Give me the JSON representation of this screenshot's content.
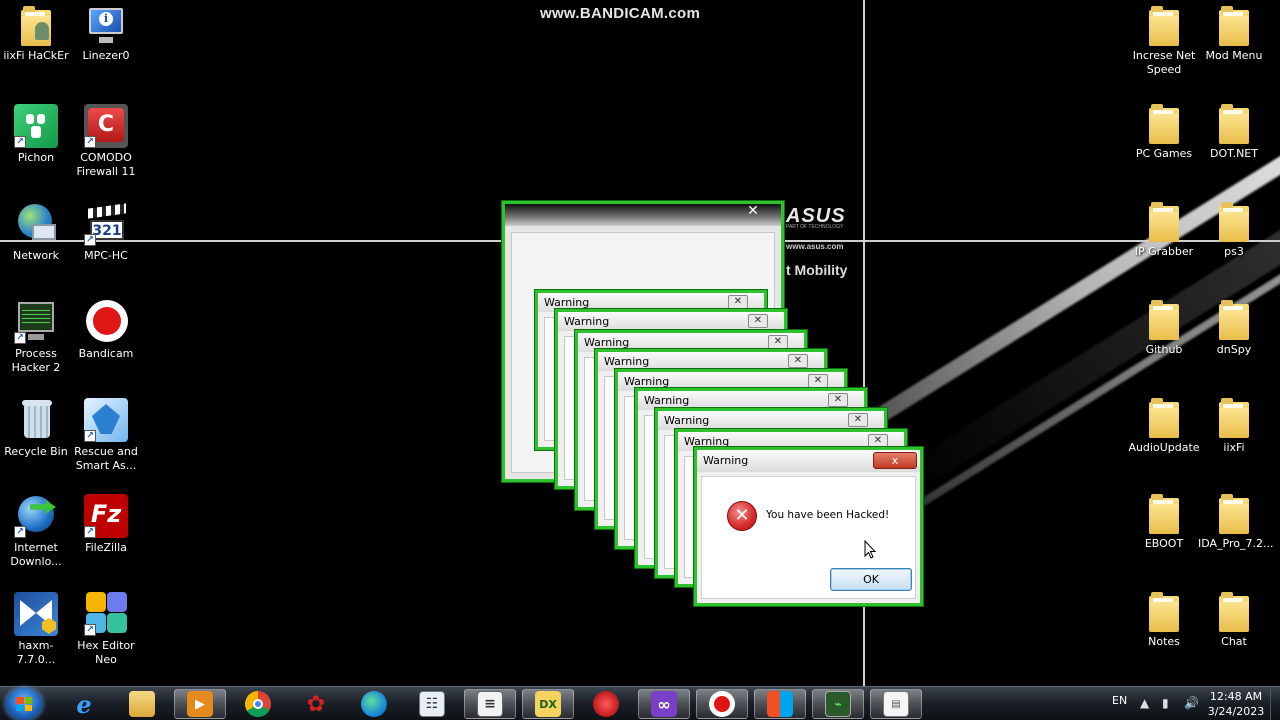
{
  "watermark": "www.BANDICAM.com",
  "wallpaper": {
    "brand": "ASUS",
    "tagline": "PART OF TECHNOLOGY",
    "url": "www.asus.com",
    "slogan": "t Mobility"
  },
  "desktop_left": [
    {
      "label": "iixFi HaCkEr",
      "icon": "folder-user-icon"
    },
    {
      "label": "Linezer0",
      "icon": "monitor-info-icon"
    },
    {
      "label": "Pichon",
      "icon": "pichon-icon"
    },
    {
      "label": "COMODO Firewall 11",
      "icon": "comodo-icon"
    },
    {
      "label": "Network",
      "icon": "network-icon"
    },
    {
      "label": "MPC-HC",
      "icon": "mpc-hc-icon"
    },
    {
      "label": "Process Hacker 2",
      "icon": "process-hacker-icon"
    },
    {
      "label": "Bandicam",
      "icon": "bandicam-icon"
    },
    {
      "label": "Recycle Bin",
      "icon": "recycle-bin-icon"
    },
    {
      "label": "Rescue and Smart As...",
      "icon": "rescue-icon"
    },
    {
      "label": "Internet Downlo...",
      "icon": "idm-icon"
    },
    {
      "label": "FileZilla",
      "icon": "filezilla-icon"
    },
    {
      "label": "haxm-7.7.0...",
      "icon": "haxm-installer-icon"
    },
    {
      "label": "Hex Editor Neo",
      "icon": "hex-editor-icon"
    }
  ],
  "desktop_right": [
    {
      "label": "Increse Net Speed"
    },
    {
      "label": "Mod Menu"
    },
    {
      "label": "PC Games"
    },
    {
      "label": "DOT.NET"
    },
    {
      "label": "IP Grabber"
    },
    {
      "label": "ps3"
    },
    {
      "label": "Github"
    },
    {
      "label": "dnSpy"
    },
    {
      "label": "AudioUpdate"
    },
    {
      "label": "iixFi"
    },
    {
      "label": "EBOOT"
    },
    {
      "label": "IDA_Pro_7.2..."
    },
    {
      "label": "Notes"
    },
    {
      "label": "Chat"
    }
  ],
  "stacked_windows": {
    "title": "Warning",
    "count": 8
  },
  "dialog": {
    "title": "Warning",
    "message": "You have been Hacked!",
    "ok_label": "OK",
    "close_label": "x"
  },
  "taskbar": {
    "apps": [
      "internet-explorer-icon",
      "file-explorer-icon",
      "media-player-icon",
      "chrome-icon",
      "fidget-spinner-icon",
      "edge-icon",
      "task-switcher-icon",
      "notepad-icon",
      "dxd-icon",
      "avira-icon",
      "visual-studio-icon",
      "bandicam-record-icon",
      "windows-tiles-icon",
      "process-monitor-icon",
      "dialog-app-icon"
    ],
    "language": "EN",
    "time": "12:48 AM",
    "date": "3/24/2023"
  },
  "colors": {
    "window_border": "#2ec22e",
    "folder": "#f2d06b",
    "error_red": "#d62a2a"
  }
}
